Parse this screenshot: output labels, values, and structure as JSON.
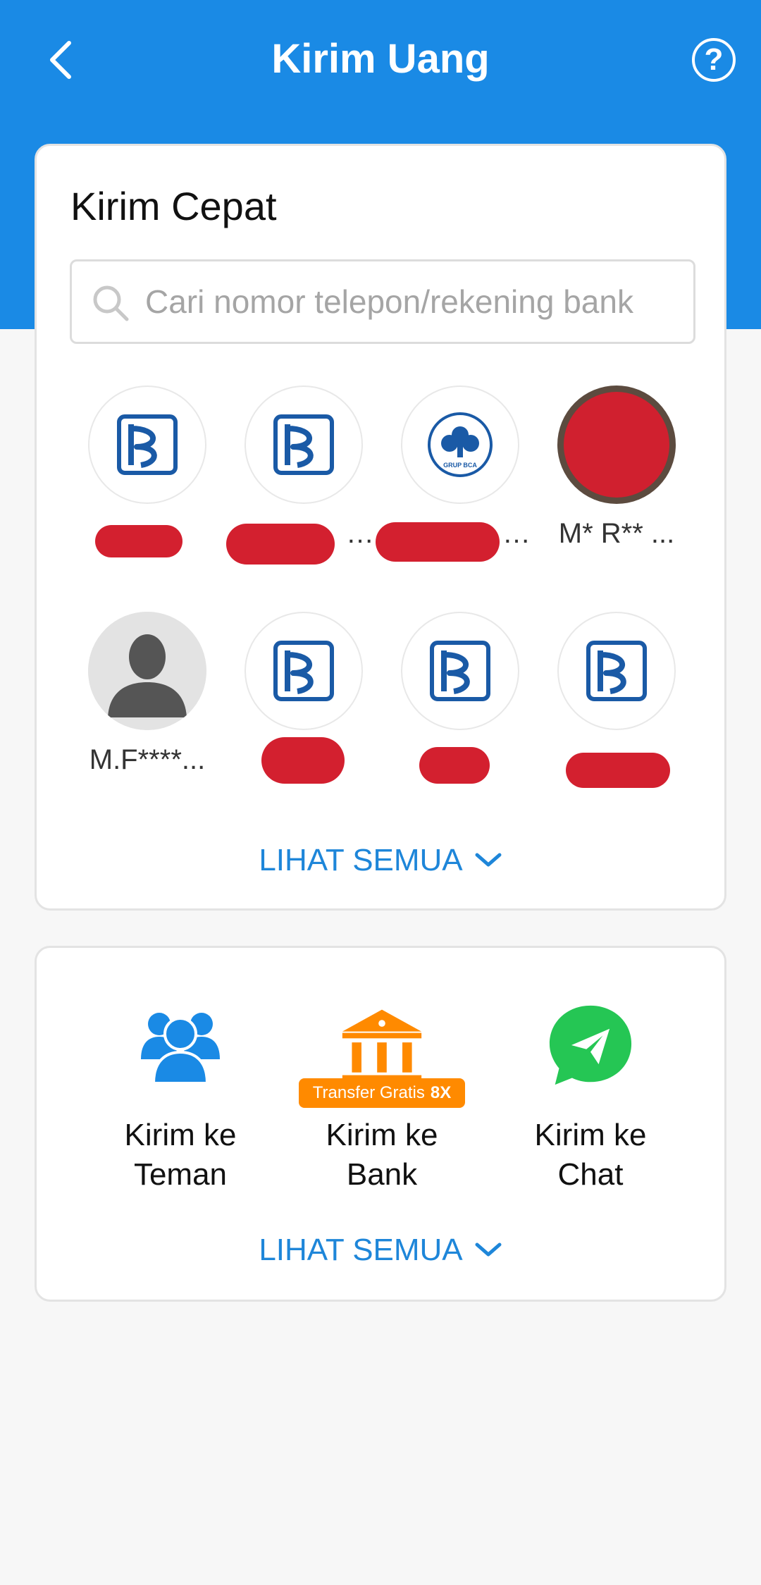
{
  "header": {
    "title": "Kirim Uang",
    "back_icon": "chevron-left-icon",
    "help_label": "?",
    "color": "#1a8ae5"
  },
  "quick_send": {
    "title": "Kirim Cepat",
    "search_placeholder": "Cari nomor telepon/rekening bank",
    "contacts": [
      {
        "name": "",
        "icon": "bri-bank-logo",
        "redacted": true
      },
      {
        "name": "…",
        "icon": "bri-bank-logo",
        "redacted": true
      },
      {
        "name": "…",
        "icon": "bca-bank-logo",
        "redacted": true
      },
      {
        "name": "M* R** ...",
        "icon": "contact-photo",
        "redacted": false
      },
      {
        "name": "M.F****...",
        "icon": "person-silhouette-icon",
        "redacted": false
      },
      {
        "name": "",
        "icon": "bri-bank-logo",
        "redacted": true
      },
      {
        "name": "",
        "icon": "bri-bank-logo",
        "redacted": true
      },
      {
        "name": "",
        "icon": "bri-bank-logo",
        "redacted": true
      }
    ],
    "see_all_label": "LIHAT SEMUA"
  },
  "send_menu": {
    "items": [
      {
        "label": "Kirim ke Teman",
        "icon": "friends-icon",
        "color": "#1a8ae5"
      },
      {
        "label": "Kirim ke Bank",
        "icon": "bank-icon",
        "color": "#ff8a00"
      },
      {
        "label": "Kirim ke Chat",
        "icon": "chat-send-icon",
        "color": "#25c654"
      }
    ],
    "promo_badge": {
      "text": "Transfer Gratis",
      "count": "8X"
    },
    "see_all_label": "LIHAT SEMUA"
  },
  "colors": {
    "accent": "#1a8ae5",
    "link": "#1e86d9",
    "promo": "#ff8a00",
    "chat": "#25c654",
    "bri_blue": "#1a5aa6"
  }
}
